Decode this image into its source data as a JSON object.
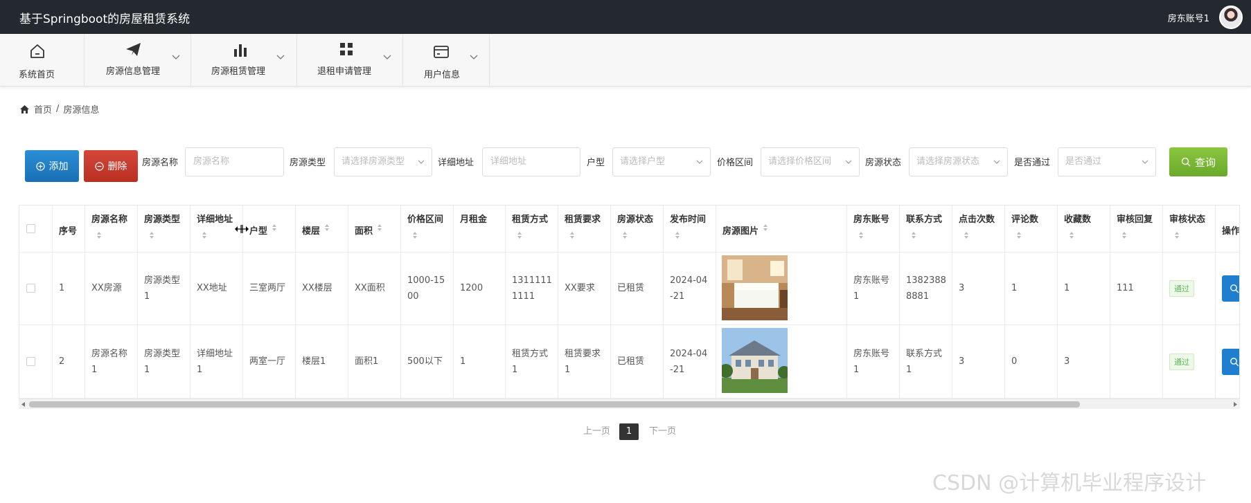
{
  "header": {
    "app_title": "基于Springboot的房屋租赁系统",
    "user_name": "房东账号1"
  },
  "nav": [
    {
      "label": "系统首页",
      "icon": "home-icon"
    },
    {
      "label": "房源信息管理",
      "icon": "paper-plane-icon"
    },
    {
      "label": "房源租赁管理",
      "icon": "bar-chart-icon"
    },
    {
      "label": "退租申请管理",
      "icon": "grid-icon"
    },
    {
      "label": "用户信息",
      "icon": "credit-card-icon"
    }
  ],
  "breadcrumb": {
    "home": "首页",
    "sep": "/",
    "current": "房源信息"
  },
  "toolbar": {
    "add_label": "添加",
    "delete_label": "删除",
    "query_label": "查询"
  },
  "filters": [
    {
      "label": "房源名称",
      "placeholder": "房源名称"
    },
    {
      "label": "房源类型",
      "placeholder": "请选择房源类型"
    },
    {
      "label": "详细地址",
      "placeholder": "详细地址"
    },
    {
      "label": "户型",
      "placeholder": "请选择户型"
    },
    {
      "label": "价格区间",
      "placeholder": "请选择价格区间"
    },
    {
      "label": "房源状态",
      "placeholder": "请选择房源状态"
    },
    {
      "label": "是否通过",
      "placeholder": "是否通过"
    }
  ],
  "table": {
    "columns": [
      "序号",
      "房源名称",
      "房源类型",
      "详细地址",
      "户型",
      "楼层",
      "面积",
      "价格区间",
      "月租金",
      "租赁方式",
      "租赁要求",
      "房源状态",
      "发布时间",
      "房源图片",
      "房东账号",
      "联系方式",
      "点击次数",
      "评论数",
      "收藏数",
      "审核回复",
      "审核状态",
      "操作"
    ],
    "rows": [
      {
        "no": "1",
        "name": [
          "XX房源"
        ],
        "type": [
          "房源类型",
          "1"
        ],
        "address": [
          "XX地址"
        ],
        "layout": [
          "三室两厅"
        ],
        "floor": [
          "XX楼层"
        ],
        "area": [
          "XX面积"
        ],
        "price_range": [
          "1000-15",
          "00"
        ],
        "rent": [
          "1200"
        ],
        "lease_mode": [
          "1311111",
          "1111"
        ],
        "lease_req": [
          "XX要求"
        ],
        "status": [
          "已租赁"
        ],
        "publish_time": [
          "2024-04",
          "-21"
        ],
        "owner": [
          "房东账号",
          "1"
        ],
        "contact": [
          "1382388",
          "8881"
        ],
        "clicks": "3",
        "comments": "1",
        "favorites": "1",
        "review_reply": "111",
        "review_status": "通过"
      },
      {
        "no": "2",
        "name": [
          "房源名称",
          "1"
        ],
        "type": [
          "房源类型",
          "1"
        ],
        "address": [
          "详细地址",
          "1"
        ],
        "layout": [
          "两室一厅"
        ],
        "floor": [
          "楼层1"
        ],
        "area": [
          "面积1"
        ],
        "price_range": [
          "500以下"
        ],
        "rent": [
          "1"
        ],
        "lease_mode": [
          "租赁方式",
          "1"
        ],
        "lease_req": [
          "租赁要求",
          "1"
        ],
        "status": [
          "已租赁"
        ],
        "publish_time": [
          "2024-04",
          "-21"
        ],
        "owner": [
          "房东账号",
          "1"
        ],
        "contact": [
          "联系方式",
          "1"
        ],
        "clicks": "3",
        "comments": "0",
        "favorites": "3",
        "review_reply": "",
        "review_status": "通过"
      }
    ]
  },
  "pagination": {
    "prev": "上一页",
    "current": "1",
    "next": "下一页"
  },
  "watermark": "CSDN @计算机毕业程序设计",
  "colors": {
    "topbar": "#23292e",
    "add": "#1a6fb5",
    "delete": "#b92f22",
    "query": "#6aa92b",
    "pass": "#5cb85c"
  }
}
